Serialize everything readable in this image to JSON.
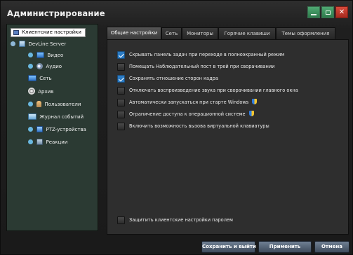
{
  "window": {
    "title": "Администрирование"
  },
  "tree": {
    "root": "Клиентские настройки",
    "items": [
      {
        "label": "DevLine Server",
        "icon": "server-icon"
      },
      {
        "label": "Видео",
        "icon": "monitor-icon"
      },
      {
        "label": "Аудио",
        "icon": "audio-icon"
      },
      {
        "label": "Сеть",
        "icon": "network-icon"
      },
      {
        "label": "Архив",
        "icon": "archive-icon"
      },
      {
        "label": "Пользователи",
        "icon": "users-icon"
      },
      {
        "label": "Журнал событий",
        "icon": "journal-icon"
      },
      {
        "label": "PTZ-устройства",
        "icon": "ptz-icon"
      },
      {
        "label": "Реакции",
        "icon": "reactions-icon"
      }
    ]
  },
  "tabs": [
    {
      "label": "Общие настройки",
      "active": true
    },
    {
      "label": "Сеть",
      "active": false
    },
    {
      "label": "Мониторы",
      "active": false
    },
    {
      "label": "Горячие клавиши",
      "active": false
    },
    {
      "label": "Темы оформления",
      "active": false
    }
  ],
  "options": [
    {
      "label": "Скрывать панель задач при переходе в полноэкранный режим",
      "checked": true
    },
    {
      "label": "Помещать Наблюдательный пост в трей при сворачивании",
      "checked": false
    },
    {
      "label": "Сохранять отношение сторон кадра",
      "checked": true
    },
    {
      "label": "Отключать воспроизведение звука при сворачивании главного окна",
      "checked": false
    },
    {
      "label": "Автоматически запускаться при старте Windows",
      "checked": false,
      "shield": true
    },
    {
      "label": "Ограничение доступа к операционной системе",
      "checked": false,
      "shield": true
    },
    {
      "label": "Включить возможность вызова виртуальной клавиатуры",
      "checked": false
    }
  ],
  "protect": {
    "label": "Защитить клиентские настройки паролем",
    "checked": false
  },
  "buttons": {
    "save_exit": "Сохранить и выйти",
    "apply": "Применить",
    "cancel": "Отмена"
  },
  "colors": {
    "accent_checkbox": "#2b7bc4",
    "close_button": "#c43a2c",
    "window_buttons": "#3f9163",
    "tree_background": "#2b3a33"
  }
}
